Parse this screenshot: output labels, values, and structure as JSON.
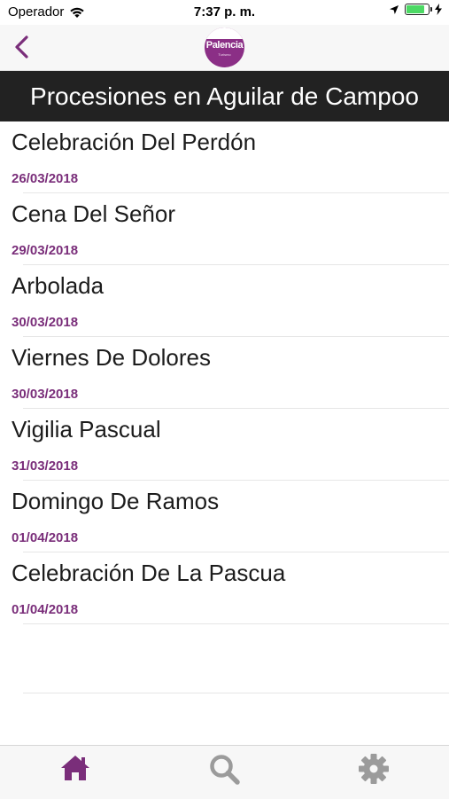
{
  "status_bar": {
    "carrier": "Operador",
    "time": "7:37 p. m."
  },
  "nav": {
    "logo_text": "Palencia",
    "logo_subtext": "Turismo"
  },
  "header": {
    "title": "Procesiones en Aguilar de Campoo"
  },
  "processions": [
    {
      "name": "Celebración Del Perdón",
      "date": "26/03/2018"
    },
    {
      "name": "Cena Del Señor",
      "date": "29/03/2018"
    },
    {
      "name": "Arbolada",
      "date": "30/03/2018"
    },
    {
      "name": "Viernes De Dolores",
      "date": "30/03/2018"
    },
    {
      "name": "Vigilia Pascual",
      "date": "31/03/2018"
    },
    {
      "name": "Domingo De Ramos",
      "date": "01/04/2018"
    },
    {
      "name": "Celebración De La Pascua",
      "date": "01/04/2018"
    }
  ],
  "tab_bar": {
    "tabs": [
      {
        "icon": "home-icon",
        "active": true
      },
      {
        "icon": "search-icon",
        "active": false
      },
      {
        "icon": "gear-icon",
        "active": false
      }
    ]
  },
  "colors": {
    "accent": "#7a2e7a",
    "banner": "#222222",
    "battery": "#4cd964",
    "tab_inactive": "#9b9b9b"
  }
}
